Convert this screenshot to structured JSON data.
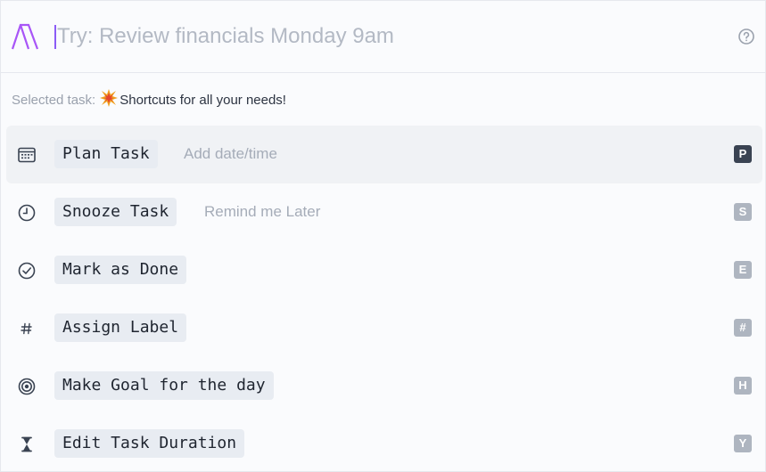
{
  "search": {
    "placeholder": "Try: Review financials Monday 9am",
    "value": ""
  },
  "selected_task": {
    "label": "Selected task:",
    "emoji": "💥",
    "value": "Shortcuts for all your needs!"
  },
  "icons": {
    "logo": "app-logo",
    "help": "question-circle-icon"
  },
  "colors": {
    "accent": "#8b5cf6",
    "key_active": "#3a4352",
    "key_inactive": "#aeb5c0",
    "pill_bg": "#e8ecf2",
    "active_row_bg": "#f0f2f5"
  },
  "actions": [
    {
      "label": "Plan Task",
      "hint": "Add date/time",
      "key": "P",
      "icon": "calendar-icon",
      "active": true
    },
    {
      "label": "Snooze Task",
      "hint": "Remind me Later",
      "key": "S",
      "icon": "clock-icon",
      "active": false
    },
    {
      "label": "Mark as Done",
      "hint": "",
      "key": "E",
      "icon": "check-circle-icon",
      "active": false
    },
    {
      "label": "Assign Label",
      "hint": "",
      "key": "#",
      "icon": "hashtag-icon",
      "active": false
    },
    {
      "label": "Make Goal for the day",
      "hint": "",
      "key": "H",
      "icon": "target-icon",
      "active": false
    },
    {
      "label": "Edit Task Duration",
      "hint": "",
      "key": "Y",
      "icon": "hourglass-icon",
      "active": false
    }
  ]
}
